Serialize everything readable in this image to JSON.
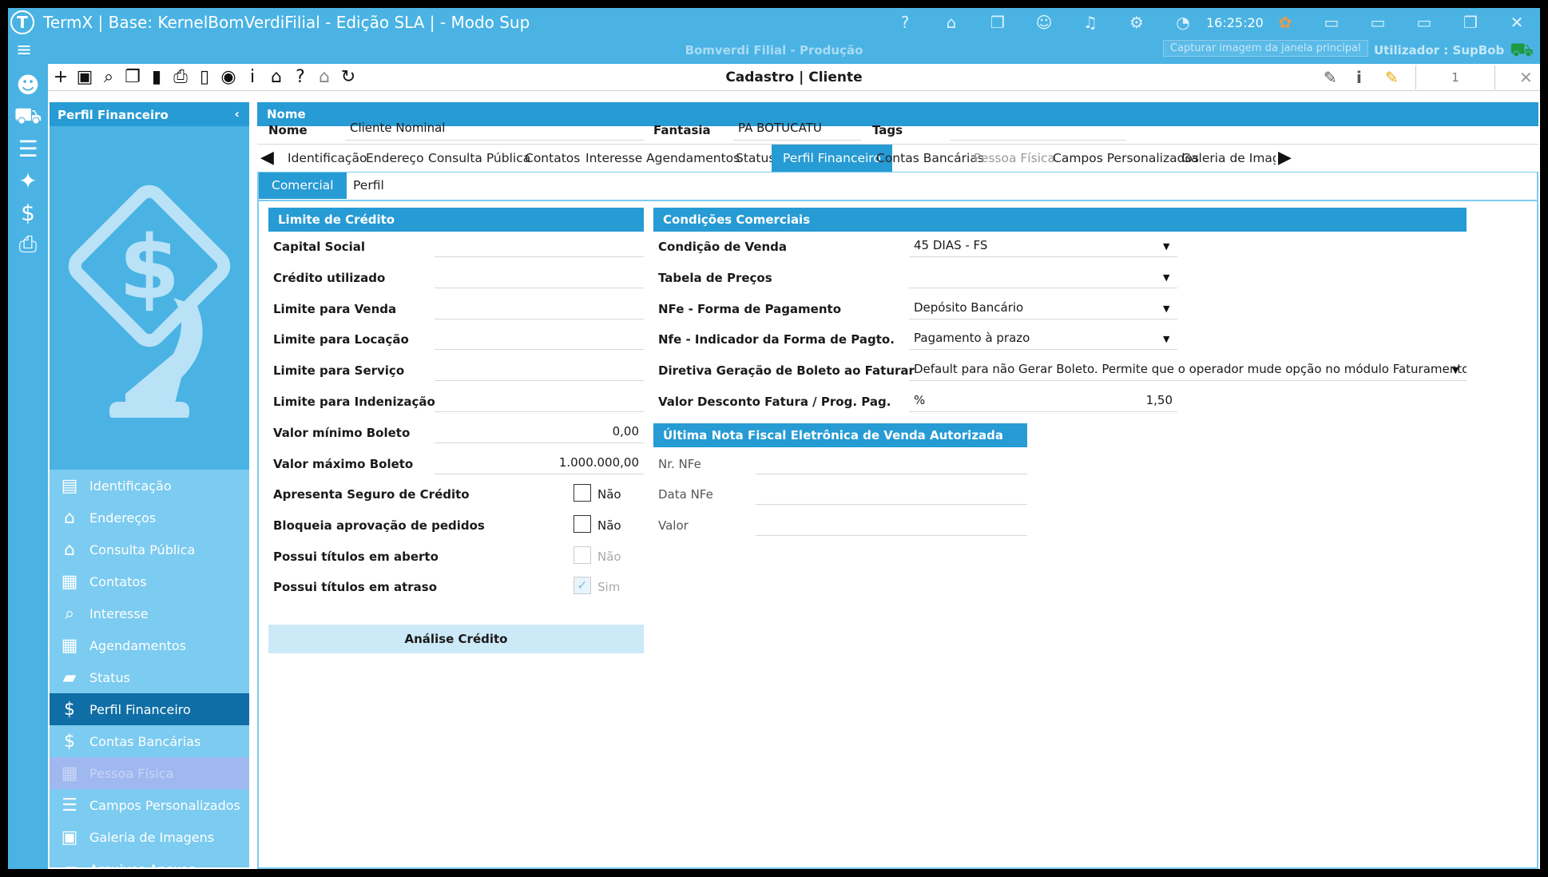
{
  "window": {
    "title": "TermX | Base: KernelBomVerdiFilial - Edição SLA | - Modo Sup",
    "clock": "16:25:20"
  },
  "bar2": {
    "environment": "Bomverdi Filial - Produção",
    "tooltip": "Capturar imagem da janela principal",
    "user": "Utilizador : SupBob"
  },
  "toolbar": {
    "page_title": "Cadastro | Cliente",
    "record_count": "1"
  },
  "left_panel": {
    "header": "Perfil Financeiro",
    "items": [
      {
        "label": "Identificação",
        "icon": "id-card-icon"
      },
      {
        "label": "Endereços",
        "icon": "home-icon"
      },
      {
        "label": "Consulta Pública",
        "icon": "home-icon"
      },
      {
        "label": "Contatos",
        "icon": "contacts-icon"
      },
      {
        "label": "Interesse",
        "icon": "magnifier-icon"
      },
      {
        "label": "Agendamentos",
        "icon": "calendar-clock-icon"
      },
      {
        "label": "Status",
        "icon": "folder-clock-icon"
      },
      {
        "label": "Perfil Financeiro",
        "icon": "money-hand-icon"
      },
      {
        "label": "Contas Bancárias",
        "icon": "dollar-icon"
      },
      {
        "label": "Pessoa Física",
        "icon": "calendar-person-icon"
      },
      {
        "label": "Campos Personalizados",
        "icon": "list-icon"
      },
      {
        "label": "Galeria de Imagens",
        "icon": "gallery-icon"
      },
      {
        "label": "Arquivos Anexos",
        "icon": "folder-attach-icon"
      }
    ]
  },
  "header": {
    "section": "Nome",
    "nome_label": "Nome",
    "nome_value": "Cliente Nominal",
    "fantasia_label": "Fantasia",
    "fantasia_value": "PA BOTUCATU",
    "tags_label": "Tags",
    "tags_value": ""
  },
  "tabs": [
    "Identificação",
    "Endereço",
    "Consulta Pública",
    "Contatos",
    "Interesse",
    "Agendamentos",
    "Status",
    "Perfil Financeiro",
    "Contas Bancárias",
    "Pessoa Física",
    "Campos Personalizados",
    "Galeria de Imagens"
  ],
  "subtabs": [
    "Comercial",
    "Perfil"
  ],
  "credito": {
    "title": "Limite de Crédito",
    "fields": [
      {
        "label": "Capital Social",
        "value": ""
      },
      {
        "label": "Crédito utilizado",
        "value": ""
      },
      {
        "label": "Limite para Venda",
        "value": ""
      },
      {
        "label": "Limite para Locação",
        "value": ""
      },
      {
        "label": "Limite para Serviço",
        "value": ""
      },
      {
        "label": "Limite para Indenização",
        "value": ""
      },
      {
        "label": "Valor mínimo Boleto",
        "value": "0,00"
      },
      {
        "label": "Valor máximo Boleto",
        "value": "1.000.000,00"
      }
    ],
    "checks": [
      {
        "label": "Apresenta Seguro de Crédito",
        "text": "Não",
        "checked": false
      },
      {
        "label": "Bloqueia aprovação de pedidos",
        "text": "Não",
        "checked": false
      },
      {
        "label": "Possui títulos em aberto",
        "text": "Não",
        "checked": false
      },
      {
        "label": "Possui títulos em atraso",
        "text": "Sim",
        "checked": true
      }
    ],
    "button": "Análise Crédito"
  },
  "comerciais": {
    "title": "Condições Comerciais",
    "fields": [
      {
        "label": "Condição de Venda",
        "value": "45 DIAS - FS"
      },
      {
        "label": "Tabela de Preços",
        "value": ""
      },
      {
        "label": "NFe - Forma de Pagamento",
        "value": "Depósito Bancário"
      },
      {
        "label": "Nfe - Indicador da Forma de Pagto.",
        "value": "Pagamento à prazo"
      },
      {
        "label": "Diretiva Geração de Boleto ao Faturar",
        "value": "Default para não Gerar Boleto. Permite que o operador mude opção no módulo Faturamento"
      },
      {
        "label": "Valor Desconto Fatura / Prog. Pag.",
        "prefix": "%",
        "value": "1,50"
      }
    ]
  },
  "nfe": {
    "title": "Última Nota Fiscal Eletrônica de Venda Autorizada",
    "fields": [
      {
        "label": "Nr. NFe",
        "value": ""
      },
      {
        "label": "Data NFe",
        "value": ""
      },
      {
        "label": "Valor",
        "value": ""
      }
    ]
  },
  "colors": {
    "accent": "#269bd4",
    "titlebar": "#4ab3e4",
    "panel": "#7ccbf0",
    "active_nav": "#0f6ea6"
  }
}
